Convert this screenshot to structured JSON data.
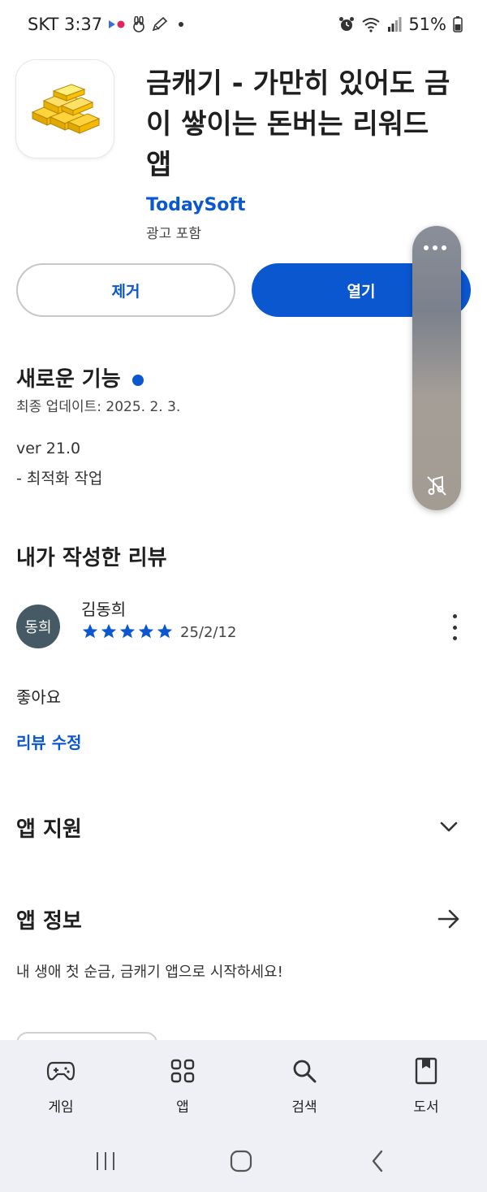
{
  "status_bar": {
    "carrier_time": "SKT 3:37",
    "battery": "51%"
  },
  "app": {
    "title": "금캐기 - 가만히 있어도 금이 쌓이는 돈버는 리워드 앱",
    "developer": "TodaySoft",
    "ads_note": "광고 포함",
    "icon": "gold-bars-icon"
  },
  "actions": {
    "uninstall_label": "제거",
    "open_label": "열기"
  },
  "whats_new": {
    "title": "새로운 기능",
    "last_updated": "최종 업데이트: 2025. 2. 3.",
    "version": "ver 21.0",
    "notes": "- 최적화 작업"
  },
  "my_review": {
    "title": "내가 작성한 리뷰",
    "avatar_text": "동희",
    "reviewer_name": "김동희",
    "rating": 5,
    "rating_max": 5,
    "date": "25/2/12",
    "body": "좋아요",
    "edit_label": "리뷰 수정"
  },
  "app_support": {
    "title": "앱 지원"
  },
  "app_info": {
    "title": "앱 정보",
    "description": "내 생애 첫 순금, 금캐기 앱으로 시작하세요!"
  },
  "bottom_nav": {
    "items": [
      {
        "label": "게임",
        "icon": "gamepad-icon"
      },
      {
        "label": "앱",
        "icon": "apps-grid-icon"
      },
      {
        "label": "검색",
        "icon": "search-icon"
      },
      {
        "label": "도서",
        "icon": "book-icon"
      }
    ]
  },
  "colors": {
    "accent": "#0b57d0",
    "avatar_bg": "#455a64"
  }
}
